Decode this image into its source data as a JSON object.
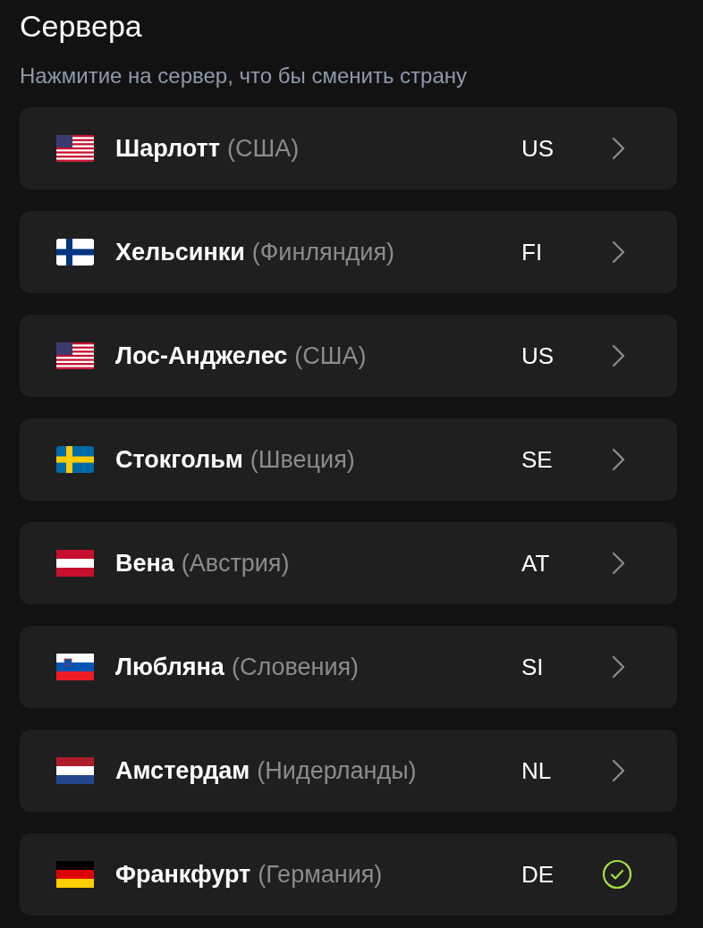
{
  "title": "Сервера",
  "subtitle": "Нажмитие на сервер, что бы сменить страну",
  "servers": [
    {
      "kind": "us",
      "city": "Шарлотт",
      "country": "(США)",
      "code": "US",
      "selected": false
    },
    {
      "kind": "fi",
      "city": "Хельсинки",
      "country": "(Финляндия)",
      "code": "FI",
      "selected": false
    },
    {
      "kind": "us",
      "city": "Лос-Анджелес",
      "country": "(США)",
      "code": "US",
      "selected": false
    },
    {
      "kind": "se",
      "city": "Стокгольм",
      "country": "(Швеция)",
      "code": "SE",
      "selected": false
    },
    {
      "kind": "at",
      "city": "Вена",
      "country": "(Австрия)",
      "code": "AT",
      "selected": false
    },
    {
      "kind": "si",
      "city": "Любляна",
      "country": "(Словения)",
      "code": "SI",
      "selected": false
    },
    {
      "kind": "nl",
      "city": "Амстердам",
      "country": "(Нидерланды)",
      "code": "NL",
      "selected": false
    },
    {
      "kind": "de",
      "city": "Франкфурт",
      "country": "(Германия)",
      "code": "DE",
      "selected": true
    }
  ]
}
